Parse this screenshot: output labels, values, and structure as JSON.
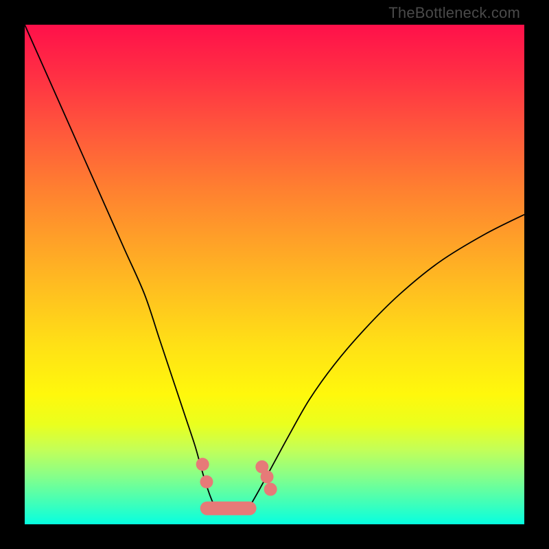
{
  "watermark": "TheBottleneck.com",
  "chart_data": {
    "type": "line",
    "title": "",
    "xlabel": "",
    "ylabel": "",
    "xlim": [
      0,
      100
    ],
    "ylim": [
      0,
      100
    ],
    "series": [
      {
        "name": "left-curve",
        "x": [
          0,
          4,
          8,
          12,
          16,
          20,
          24,
          27,
          30,
          32,
          34,
          35,
          36,
          37,
          38
        ],
        "y": [
          100,
          91,
          82,
          73,
          64,
          55,
          46,
          37,
          28,
          22,
          16,
          12.5,
          9,
          6,
          3.5
        ]
      },
      {
        "name": "right-curve",
        "x": [
          45,
          47,
          50,
          53,
          57,
          62,
          68,
          75,
          83,
          92,
          100
        ],
        "y": [
          3.5,
          7,
          12.5,
          18,
          25,
          32,
          39,
          46,
          52.5,
          58,
          62
        ]
      }
    ],
    "markers": [
      {
        "x": 35.6,
        "y": 12.0
      },
      {
        "x": 36.4,
        "y": 8.5
      },
      {
        "x": 47.5,
        "y": 11.5
      },
      {
        "x": 48.5,
        "y": 9.5
      },
      {
        "x": 49.2,
        "y": 7.0
      }
    ],
    "flat_segment": {
      "x0": 36.5,
      "x1": 45.0,
      "y": 3.2
    },
    "colors": {
      "marker": "#e67a78",
      "curve": "#000000"
    }
  }
}
